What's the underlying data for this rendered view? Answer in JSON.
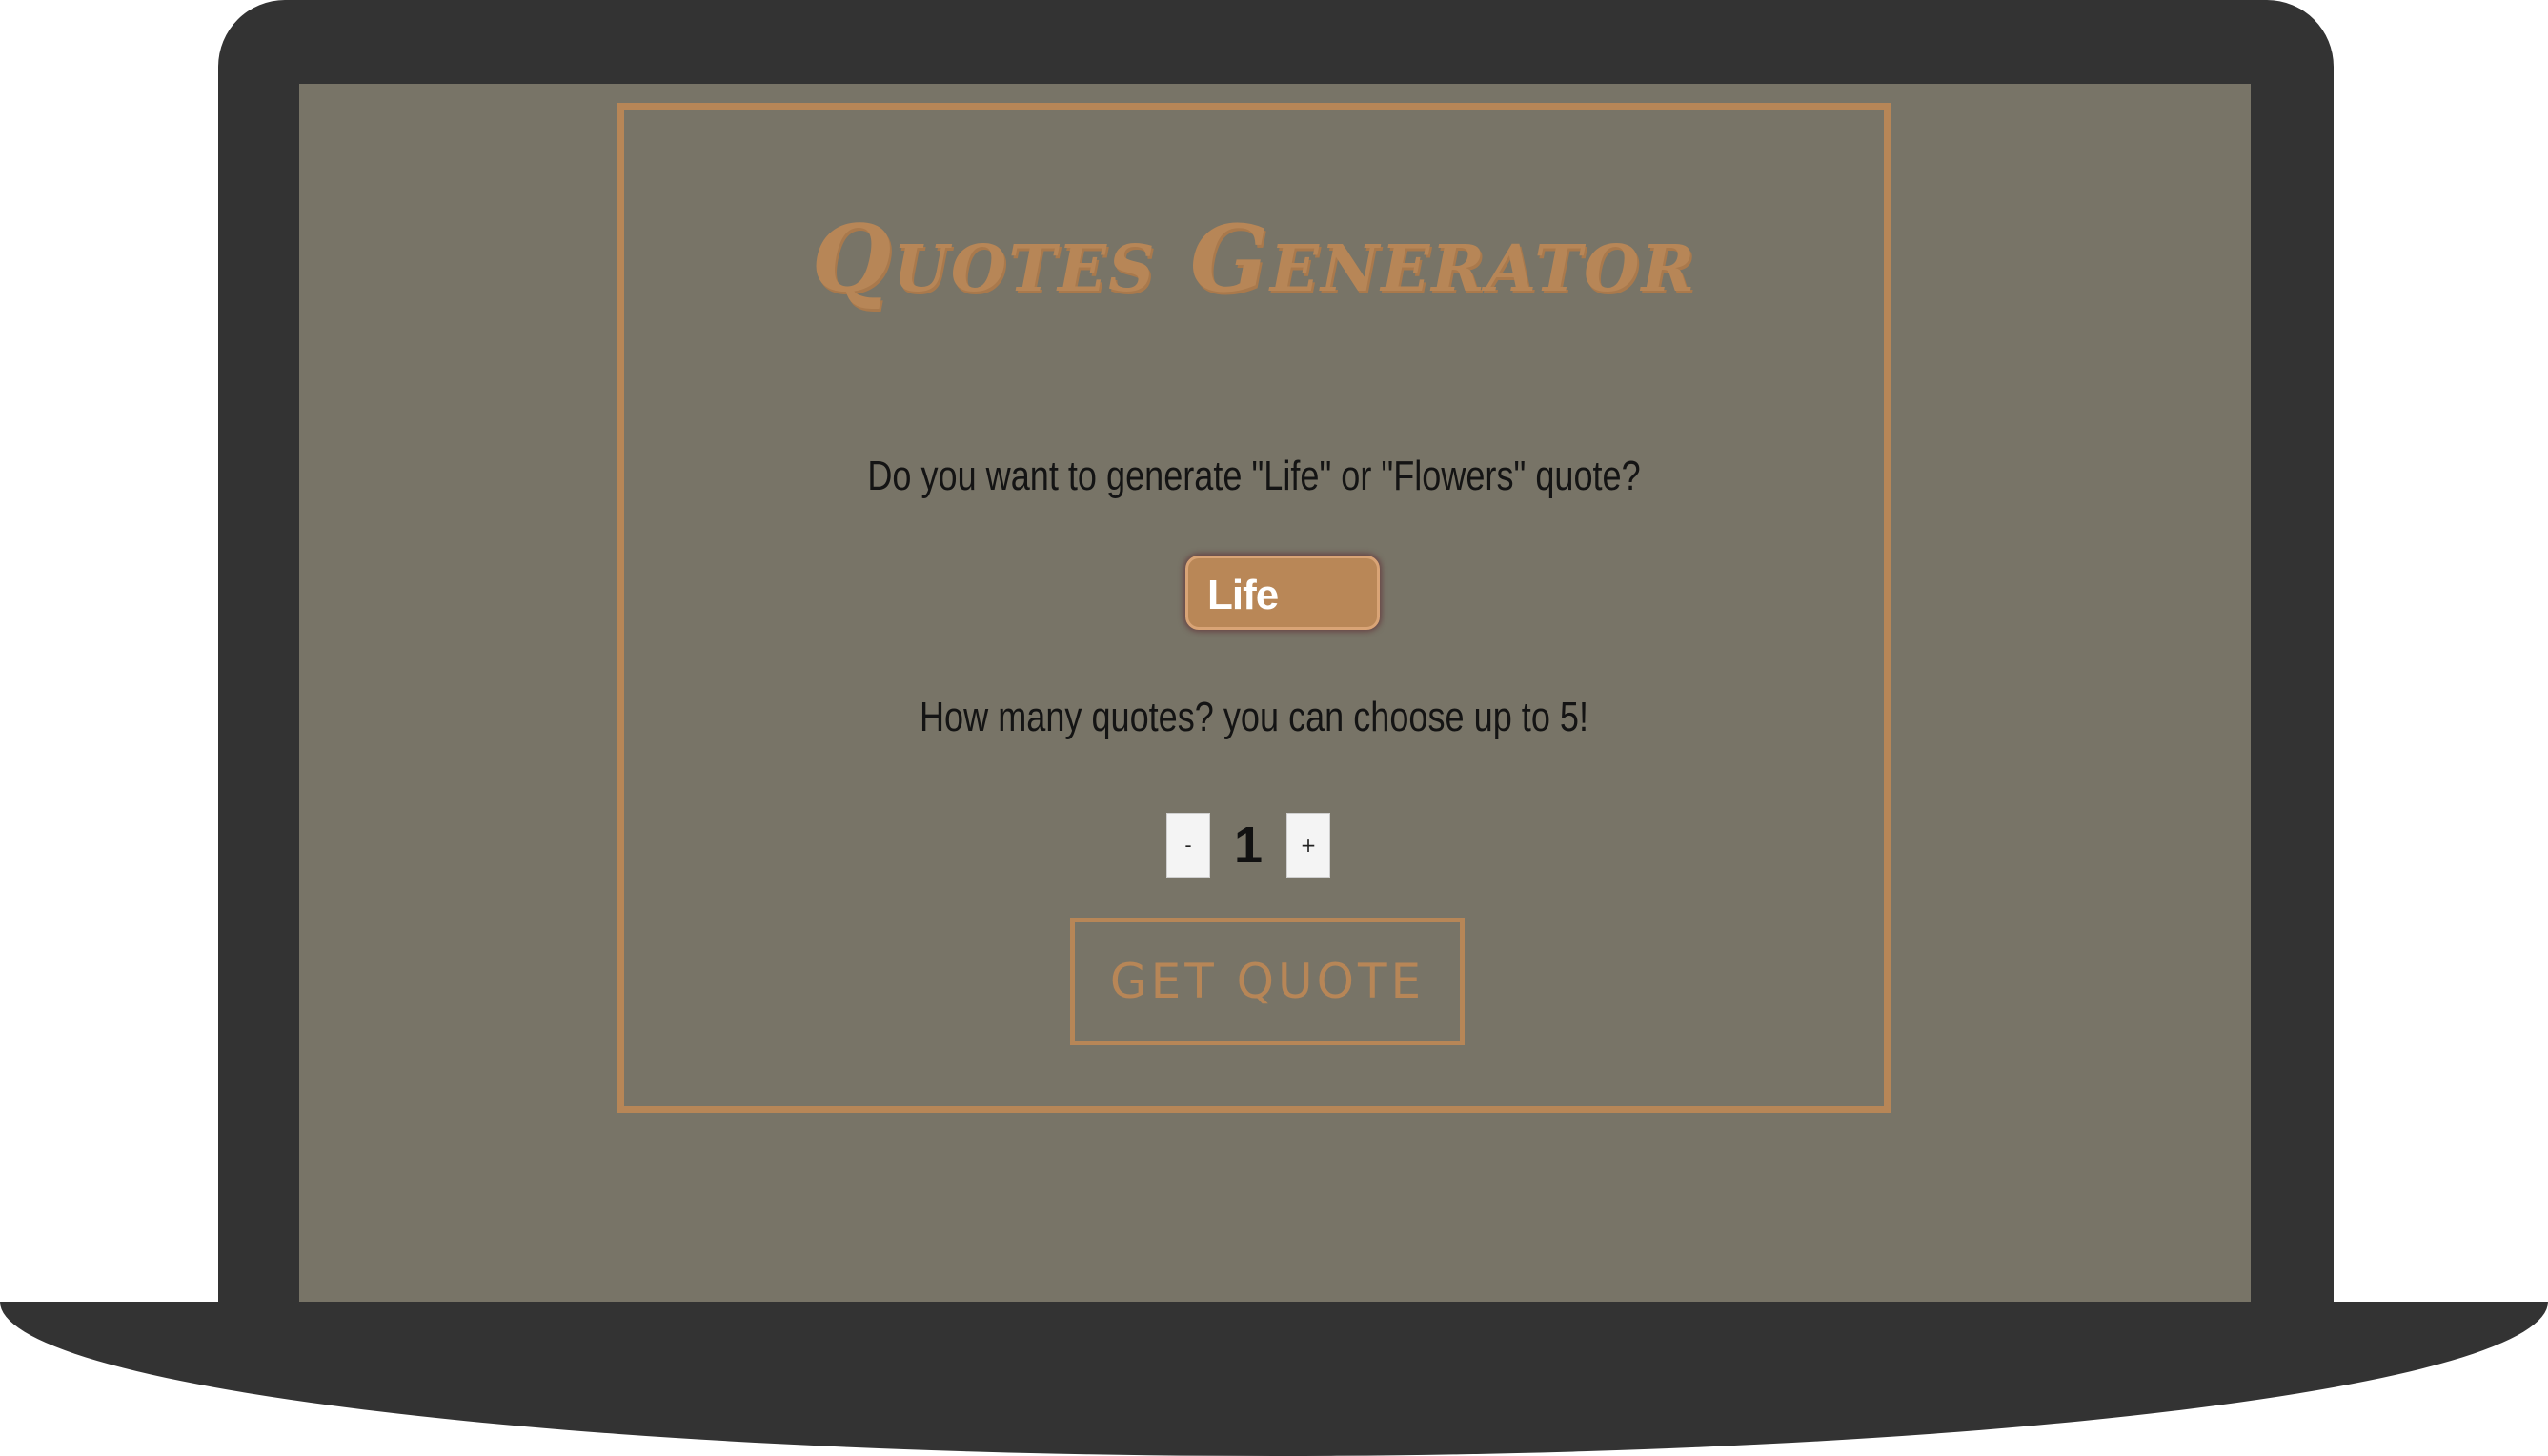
{
  "app": {
    "title": "Quotes Generator"
  },
  "type_question": {
    "text": "Do you want to generate \"Life\" or \"Flowers\" quote?"
  },
  "type_select": {
    "selected": "Life"
  },
  "count_question": {
    "text": "How many quotes? you can choose up to 5!"
  },
  "stepper": {
    "minus_label": "-",
    "value": "1",
    "plus_label": "+"
  },
  "actions": {
    "get_quote_label": "Get Quote"
  },
  "colors": {
    "accent": "#b78657",
    "background": "#787467",
    "frame": "#333333"
  }
}
